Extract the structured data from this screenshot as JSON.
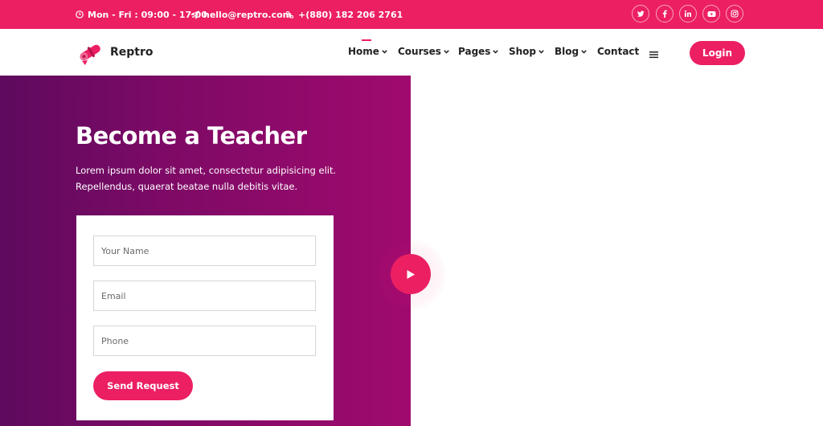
{
  "colors": {
    "accent": "#ec1f63",
    "hero_start": "#5e0a5e",
    "hero_end": "#a00a6e"
  },
  "topbar": {
    "hours": "Mon - Fri : 09:00 - 17:00",
    "email": "hello@reptro.com",
    "phone": "+(880) 182 206 2761",
    "social": [
      "twitter-icon",
      "facebook-icon",
      "linkedin-icon",
      "youtube-icon",
      "instagram-icon"
    ]
  },
  "brand": {
    "name": "Reptro"
  },
  "nav": {
    "items": [
      {
        "label": "Home",
        "dropdown": true,
        "active": true
      },
      {
        "label": "Courses",
        "dropdown": true
      },
      {
        "label": "Pages",
        "dropdown": true
      },
      {
        "label": "Shop",
        "dropdown": true
      },
      {
        "label": "Blog",
        "dropdown": true
      },
      {
        "label": "Contact",
        "dropdown": false
      }
    ],
    "login_label": "Login"
  },
  "hero": {
    "title": "Become a Teacher",
    "description": "Lorem ipsum dolor sit amet, consectetur adipisicing elit. Repellendus, quaerat beatae nulla debitis vitae."
  },
  "form": {
    "name_placeholder": "Your Name",
    "email_placeholder": "Email",
    "phone_placeholder": "Phone",
    "submit_label": "Send Request"
  }
}
